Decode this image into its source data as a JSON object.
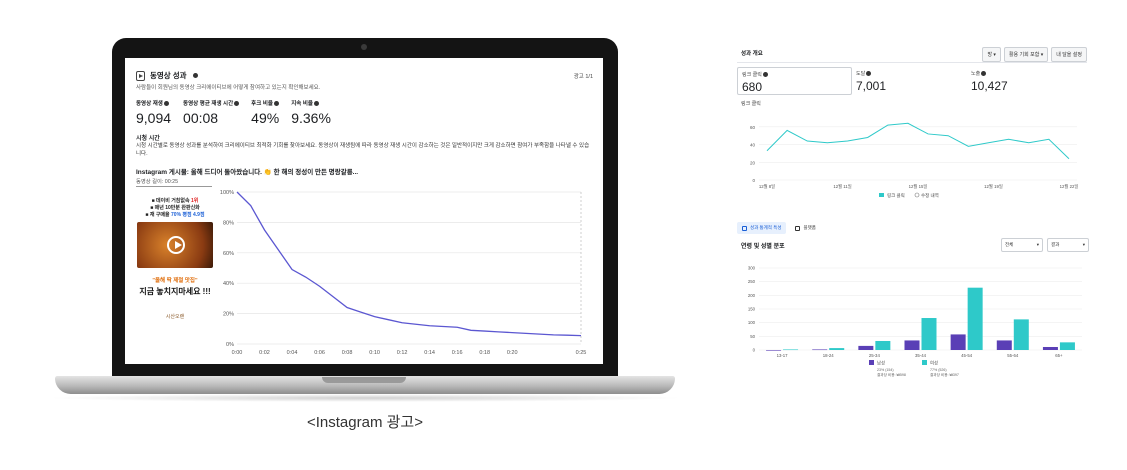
{
  "caption": "<Instagram 광고>",
  "colors": {
    "retention_line": "#5b57d1",
    "women": "#2ec9c9",
    "men": "#5a3fb6",
    "reach_line": "#2ec9c9"
  },
  "screen": {
    "title": "동영상 성과",
    "page_indicator": "광고 1/1",
    "subtitle": "사람들이 회원님의 동영상 크리에이티브에 어떻게 참여하고 있는지 확인해보세요.",
    "metrics": [
      {
        "label": "동영상 재생",
        "value": "9,094"
      },
      {
        "label": "동영상 평균 재생 시간",
        "value": "00:08"
      },
      {
        "label": "후크 비율",
        "value": "49%"
      },
      {
        "label": "지속 비율",
        "value": "9.36%"
      }
    ],
    "section_title": "시청 시간",
    "section_desc": "시청 시간별로 동영상 성과를 분석하여 크리에이티브 최적화 기회를 찾아보세요. 동영상이 재생됨에 따라 동영상 재생 시간이 감소하는 것은 일반적이지만 크게 감소하면 참여가 부족함을 나타낼 수 있습니다.",
    "post_title": "Instagram 게시물: 올해 드디어 돌아왔습니다. 👏 한 해의 정성이 만든 명랑갈릉...",
    "video_length": "동영상 길이: 00:25",
    "ad": {
      "line1_a": "■ 데이비 거침없속 ",
      "line1_b": "1위",
      "line2": "■ 매년 10만분 완판신화",
      "line3_a": "■ 재 구매율 ",
      "line3_b": "70% 평점 4.9점",
      "slogan": "\"올해 딱 제철 맛집\"",
      "cta": "지금 놓치지마세요 !!!",
      "brand": "시산오랜"
    },
    "chart_data": {
      "type": "line",
      "x": [
        "0:00",
        "0:02",
        "0:04",
        "0:06",
        "0:08",
        "0:10",
        "0:12",
        "0:14",
        "0:16",
        "0:18",
        "0:20",
        "0:25"
      ],
      "x_seconds": [
        0,
        1,
        2,
        3,
        4,
        5,
        6,
        7,
        8,
        9,
        10,
        11,
        12,
        13,
        14,
        15,
        16,
        17,
        18,
        19,
        20,
        21,
        22,
        23,
        24,
        25
      ],
      "values": [
        100,
        91,
        75,
        62,
        49,
        44,
        38,
        31,
        24,
        21,
        18,
        16,
        14,
        13,
        12,
        11.5,
        11,
        9,
        8.5,
        8,
        7.5,
        7,
        6.5,
        6,
        5.8,
        5.5
      ],
      "yticks": [
        "100%",
        "80%",
        "60%",
        "40%",
        "20%",
        "0%"
      ],
      "ylim": [
        0,
        100
      ]
    }
  },
  "panel": {
    "title": "성과 개요",
    "controls": [
      "방 ▾",
      "활용 기회 포함 ▾",
      "내 달을 설정"
    ],
    "kpis": [
      {
        "label": "링크 클릭",
        "value": "680"
      },
      {
        "label": "도달",
        "value": "7,001"
      },
      {
        "label": "노출",
        "value": "10,427"
      }
    ],
    "kpi_section": "링크 클릭",
    "chart_data": {
      "type": "line",
      "x_labels": [
        "12월 8일",
        "12월 11일",
        "12월 15일",
        "12월 19일",
        "12월 22일"
      ],
      "values": [
        33,
        56,
        44,
        42,
        44,
        48,
        62,
        64,
        52,
        50,
        38,
        42,
        46,
        42,
        46,
        24
      ],
      "yticks": [
        0,
        20,
        40,
        60
      ],
      "ylim": [
        0,
        70
      ],
      "legend": [
        "링크 클릭",
        "수정 내역"
      ]
    },
    "tabs": [
      "성과 통계적 특성",
      "플랫폼"
    ],
    "demo_title": "연령 및 성별 분포",
    "selects": [
      "전체",
      "결과"
    ],
    "bar_chart_data": {
      "type": "bar",
      "categories": [
        "13-17",
        "18-24",
        "25-34",
        "35-44",
        "45-54",
        "55-64",
        "65+"
      ],
      "series": [
        {
          "name": "남성",
          "values": [
            0,
            2,
            15,
            35,
            57,
            35,
            11
          ]
        },
        {
          "name": "여성",
          "values": [
            2,
            7,
            33,
            117,
            228,
            112,
            28
          ]
        }
      ],
      "yticks": [
        0,
        50,
        100,
        150,
        200,
        250,
        300
      ],
      "ylim": [
        0,
        300
      ],
      "legend_notes": [
        "23% (154)",
        "77% (526)",
        "결과당 비용: ₩598",
        "결과당 비용: ₩397"
      ]
    }
  }
}
